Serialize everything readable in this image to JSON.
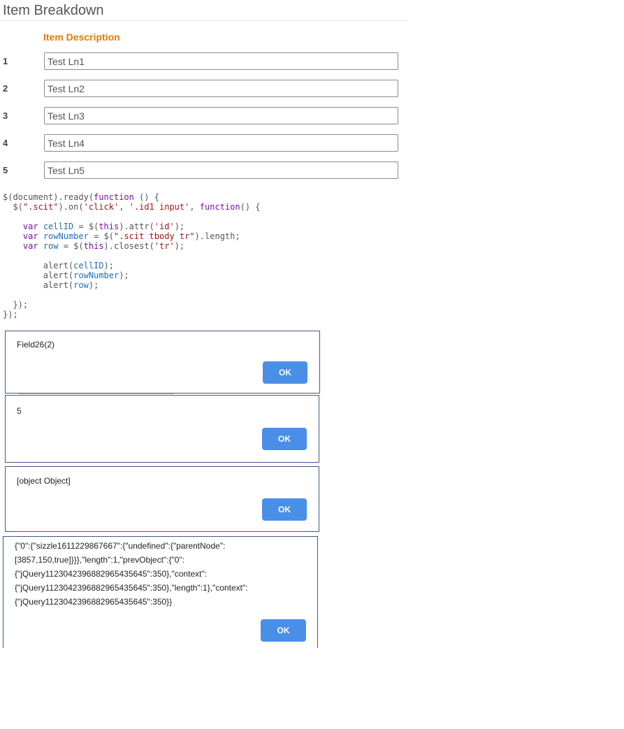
{
  "page": {
    "title": "Item Breakdown",
    "column_header": "Item Description"
  },
  "rows": [
    {
      "number": "1",
      "value": "Test Ln1"
    },
    {
      "number": "2",
      "value": "Test Ln2"
    },
    {
      "number": "3",
      "value": "Test Ln3"
    },
    {
      "number": "4",
      "value": "Test Ln4"
    },
    {
      "number": "5",
      "value": "Test Ln5"
    }
  ],
  "code": {
    "lines": [
      "$(document).ready(function () {",
      "  $(\".scit\").on('click', '.id1 input', function() {",
      "",
      "    var cellID = $(this).attr('id');",
      "    var rowNumber = $(\".scit tbody tr\").length;",
      "    var row = $(this).closest('tr');",
      "",
      "        alert(cellID);",
      "        alert(rowNumber);",
      "        alert(row);",
      "",
      "  });",
      "});"
    ]
  },
  "alerts": [
    {
      "message": "Field26(2)",
      "ok_label": "OK"
    },
    {
      "message": "5",
      "ok_label": "OK"
    },
    {
      "message": "[object Object]",
      "ok_label": "OK"
    },
    {
      "message_lines": [
        "{\"0\":{\"sizzle1611229867667\":{\"undefined\":{\"parentNode\":",
        "[3857,150,true]}}},\"length\":1,\"prevObject\":{\"0\":",
        "{\"jQuery1123042396882965435645\":350},\"context\":",
        "{\"jQuery1123042396882965435645\":350},\"length\":1},\"context\":",
        "{\"jQuery1123042396882965435645\":350}}"
      ],
      "ok_label": "OK"
    }
  ]
}
